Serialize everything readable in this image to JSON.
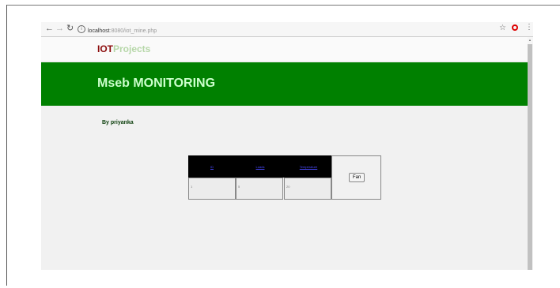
{
  "browser": {
    "url_host": "localhost",
    "url_path": ":8080/iot_mine.php"
  },
  "site": {
    "logo_part1": "IOT",
    "logo_part2": "Projects",
    "banner_title": "Mseb MONITORING",
    "author": "By priyanka"
  },
  "table": {
    "headers": [
      "ID",
      "Loads",
      "Temperature"
    ],
    "row": [
      "1",
      "5",
      "20"
    ]
  },
  "fan_button": "Fan",
  "colors": {
    "banner": "#008000",
    "banner_text": "#ccffcc",
    "logo_iot": "#8b0b0b",
    "logo_projects": "#b6d7a8",
    "header_bg": "#000000",
    "header_link": "#4b4bff"
  }
}
